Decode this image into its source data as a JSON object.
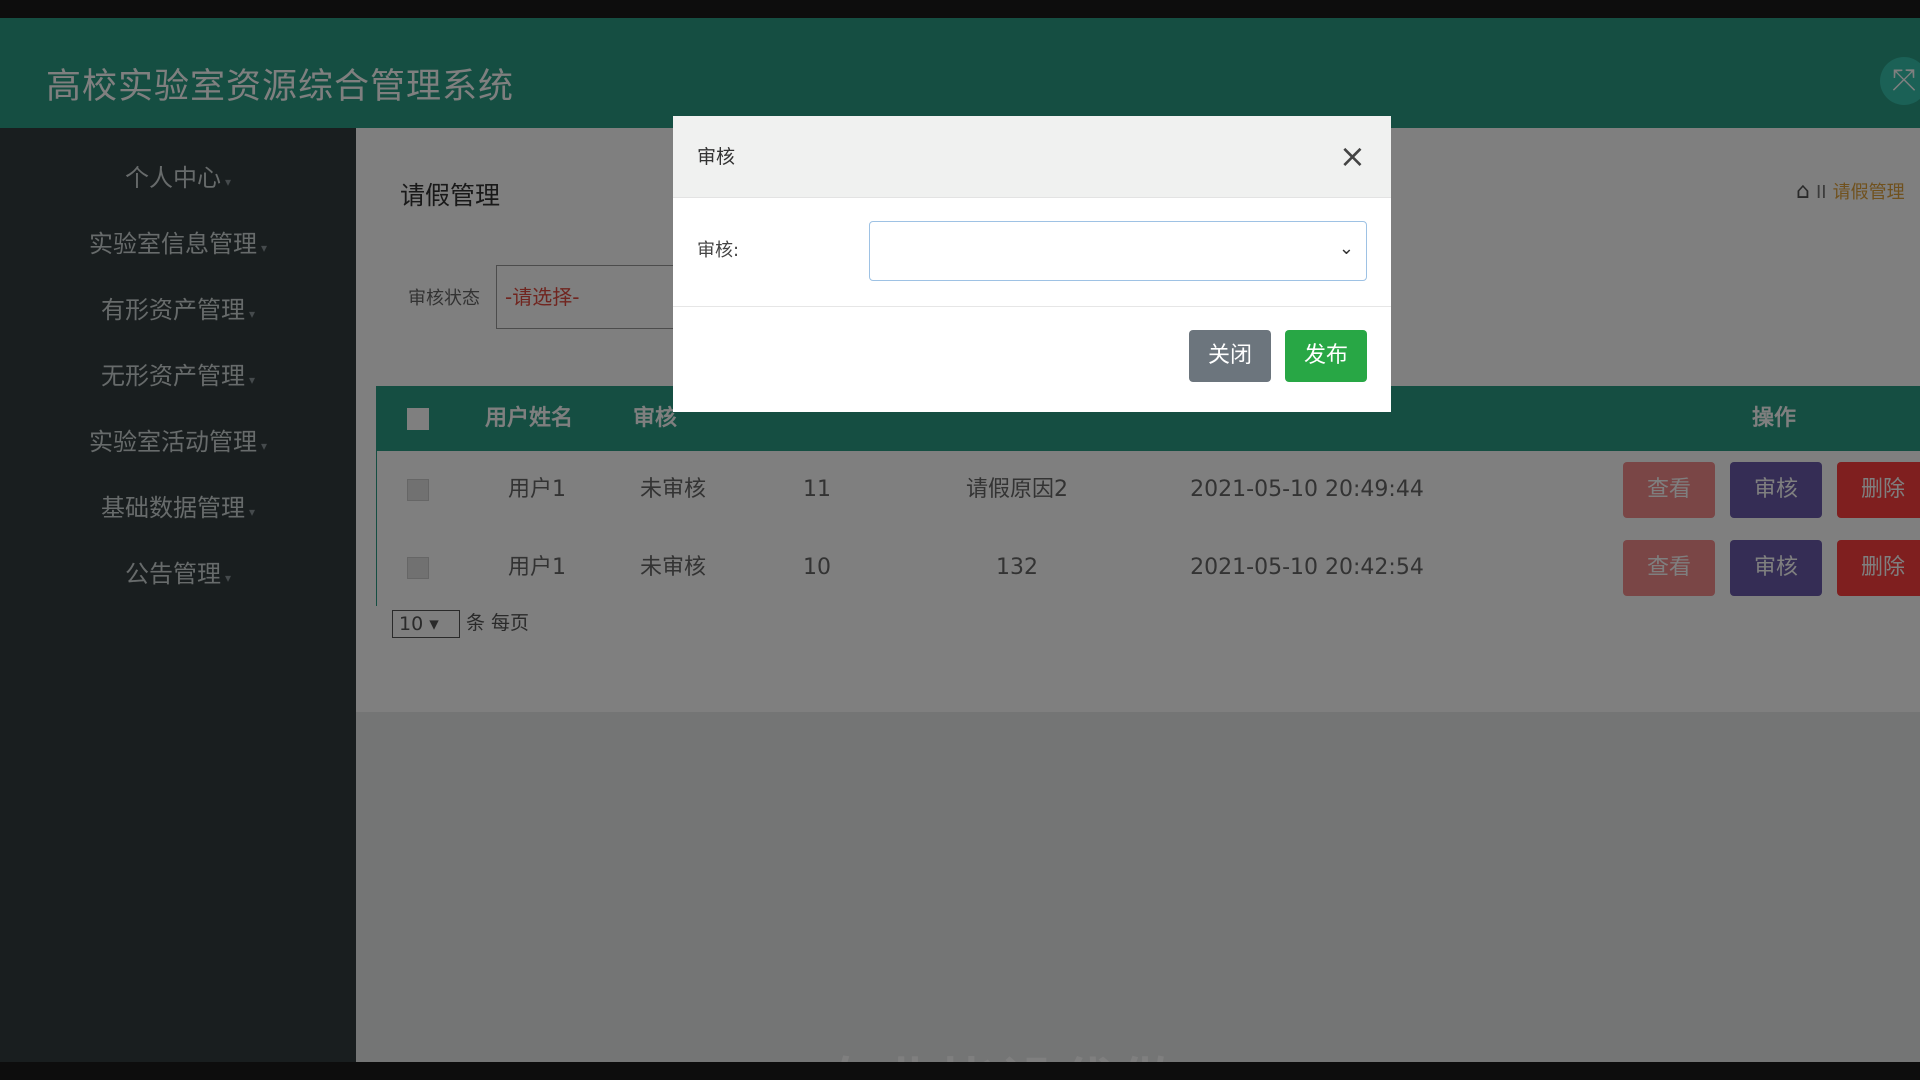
{
  "app": {
    "title": "高校实验室资源综合管理系统",
    "toggle_glyph": "⤧"
  },
  "sidebar": {
    "items": [
      {
        "label": "个人中心"
      },
      {
        "label": "实验室信息管理"
      },
      {
        "label": "有形资产管理"
      },
      {
        "label": "无形资产管理"
      },
      {
        "label": "实验室活动管理"
      },
      {
        "label": "基础数据管理"
      },
      {
        "label": "公告管理"
      }
    ]
  },
  "page": {
    "title": "请假管理",
    "breadcrumb": {
      "home_glyph": "⌂",
      "separator": "II",
      "current": "请假管理"
    }
  },
  "filter": {
    "label": "审核状态",
    "value": "-请选择-"
  },
  "table": {
    "headers": {
      "user_name": "用户姓名",
      "audit": "审核",
      "actions": "操作"
    },
    "rows": [
      {
        "user": "用户1",
        "status": "未审核",
        "days": "11",
        "reason": "请假原因2",
        "time": "2021-05-10 20:49:44"
      },
      {
        "user": "用户1",
        "status": "未审核",
        "days": "10",
        "reason": "132",
        "time": "2021-05-10 20:42:54"
      }
    ],
    "buttons": {
      "view": "查看",
      "audit": "审核",
      "delete": "删除"
    }
  },
  "pager": {
    "size": "10",
    "unit": "条 每页"
  },
  "subtitle": "专业毕设代做",
  "modal": {
    "title": "审核",
    "close_glyph": "×",
    "field_label": "审核:",
    "select_value": "",
    "close_button": "关闭",
    "publish_button": "发布"
  },
  "colors": {
    "header": "#2a9d85",
    "sidebar": "#333c3f",
    "view_button": "#f58c8c",
    "audit_button": "#6a5aaa",
    "delete_button": "#ff3f3f",
    "publish_button": "#28a745",
    "close_button": "#6c757d"
  }
}
